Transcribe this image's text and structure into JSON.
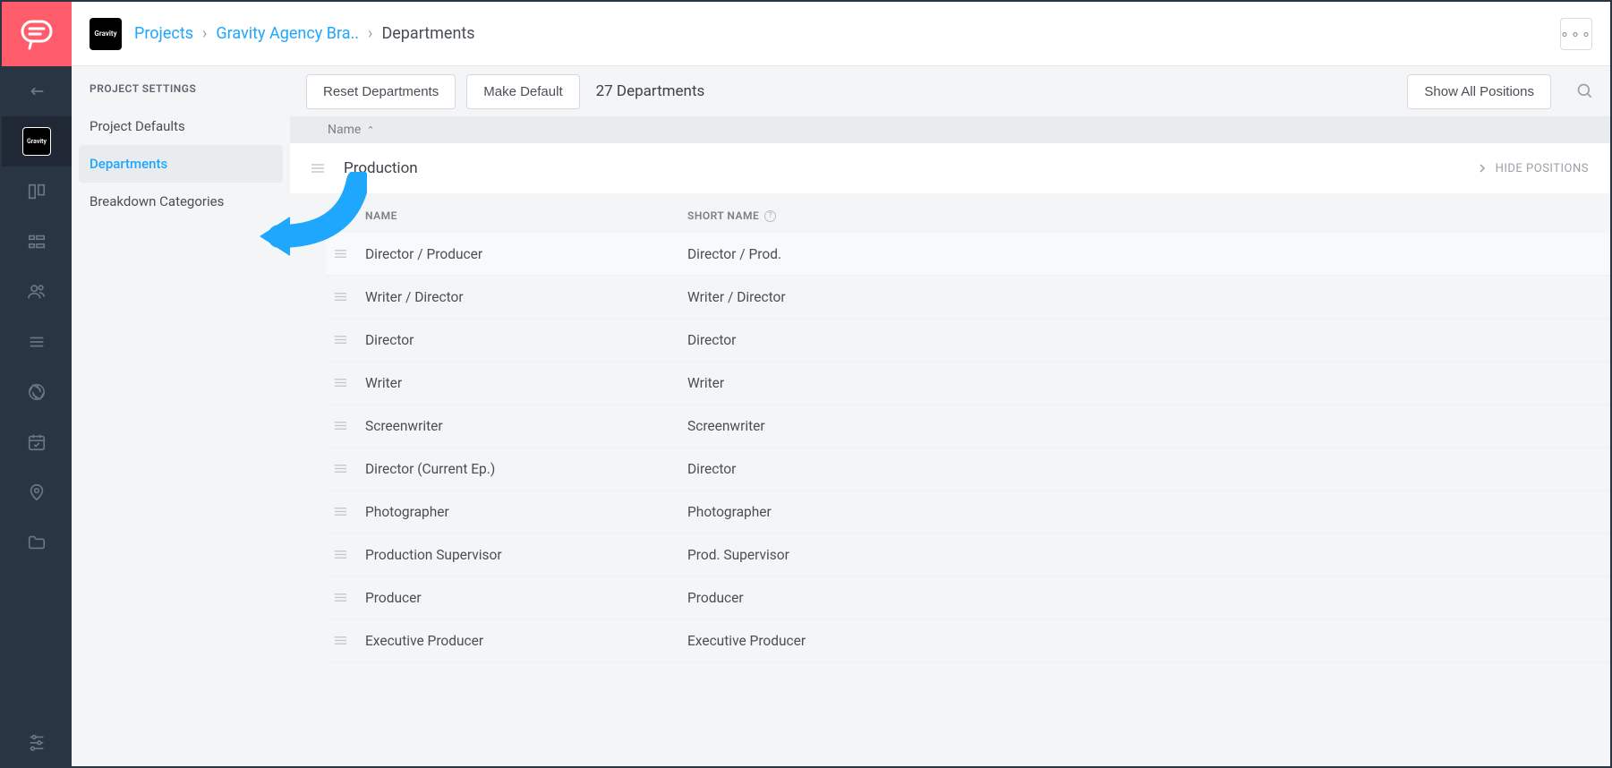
{
  "breadcrumb": {
    "projects": "Projects",
    "project": "Gravity Agency Bra..",
    "current": "Departments"
  },
  "project_badge": "Gravity",
  "sidebar": {
    "title": "PROJECT SETTINGS",
    "items": [
      {
        "label": "Project Defaults"
      },
      {
        "label": "Departments"
      },
      {
        "label": "Breakdown Categories"
      }
    ]
  },
  "toolbar": {
    "reset": "Reset Departments",
    "make_default": "Make Default",
    "count": "27 Departments",
    "show_all": "Show All Positions"
  },
  "sort": {
    "label": "Name"
  },
  "group": {
    "title": "Production",
    "toggle": "HIDE POSITIONS"
  },
  "columns": {
    "name": "NAME",
    "short": "SHORT NAME"
  },
  "positions": [
    {
      "name": "Director / Producer",
      "short": "Director / Prod."
    },
    {
      "name": "Writer / Director",
      "short": "Writer / Director"
    },
    {
      "name": "Director",
      "short": "Director"
    },
    {
      "name": "Writer",
      "short": "Writer"
    },
    {
      "name": "Screenwriter",
      "short": "Screenwriter"
    },
    {
      "name": "Director (Current Ep.)",
      "short": "Director"
    },
    {
      "name": "Photographer",
      "short": "Photographer"
    },
    {
      "name": "Production Supervisor",
      "short": "Prod. Supervisor"
    },
    {
      "name": "Producer",
      "short": "Producer"
    },
    {
      "name": "Executive Producer",
      "short": "Executive Producer"
    }
  ]
}
